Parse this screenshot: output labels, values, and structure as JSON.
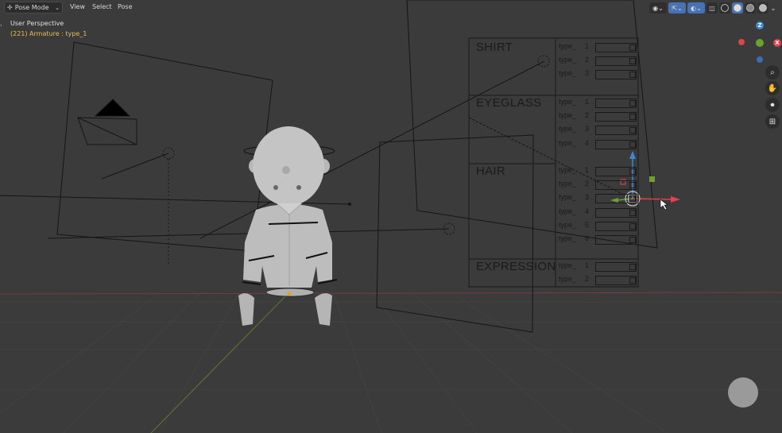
{
  "header": {
    "mode_label": "Pose Mode",
    "menus": [
      "View",
      "Select",
      "Pose"
    ]
  },
  "overlay": {
    "view_name": "User Perspective",
    "object_info": "(221) Armature : type_1"
  },
  "panel": {
    "sections": [
      {
        "label": "SHIRT",
        "rows": [
          {
            "label": "type_",
            "num": "1"
          },
          {
            "label": "type_",
            "num": "2"
          },
          {
            "label": "type_",
            "num": "3"
          }
        ]
      },
      {
        "label": "EYEGLASS",
        "rows": [
          {
            "label": "type_",
            "num": "1"
          },
          {
            "label": "type_",
            "num": "2"
          },
          {
            "label": "type_",
            "num": "3"
          },
          {
            "label": "type_",
            "num": "4"
          }
        ]
      },
      {
        "label": "HAIR",
        "rows": [
          {
            "label": "type_",
            "num": "1"
          },
          {
            "label": "type_",
            "num": "2"
          },
          {
            "label": "type_",
            "num": "3"
          },
          {
            "label": "type_",
            "num": "4"
          },
          {
            "label": "type_",
            "num": "5"
          },
          {
            "label": "type_",
            "num": "6"
          }
        ]
      },
      {
        "label": "EXPRESSION",
        "rows": [
          {
            "label": "type_",
            "num": "1"
          },
          {
            "label": "type_",
            "num": "2"
          }
        ]
      }
    ]
  },
  "gizmo": {
    "z": "Z",
    "x": "X"
  },
  "icons": [
    "pose-mode-icon",
    "visibility-icon",
    "gizmo-icon",
    "overlay-icon",
    "xray-icon",
    "shading-solid-icon",
    "zoom-icon",
    "hand-icon",
    "camera-icon",
    "grid-icon"
  ],
  "colors": {
    "background": "#3b3b3b",
    "x_axis": "#e0424f",
    "y_axis": "#6aa52a",
    "z_axis": "#3d87db",
    "info_text": "#e6c04a"
  }
}
